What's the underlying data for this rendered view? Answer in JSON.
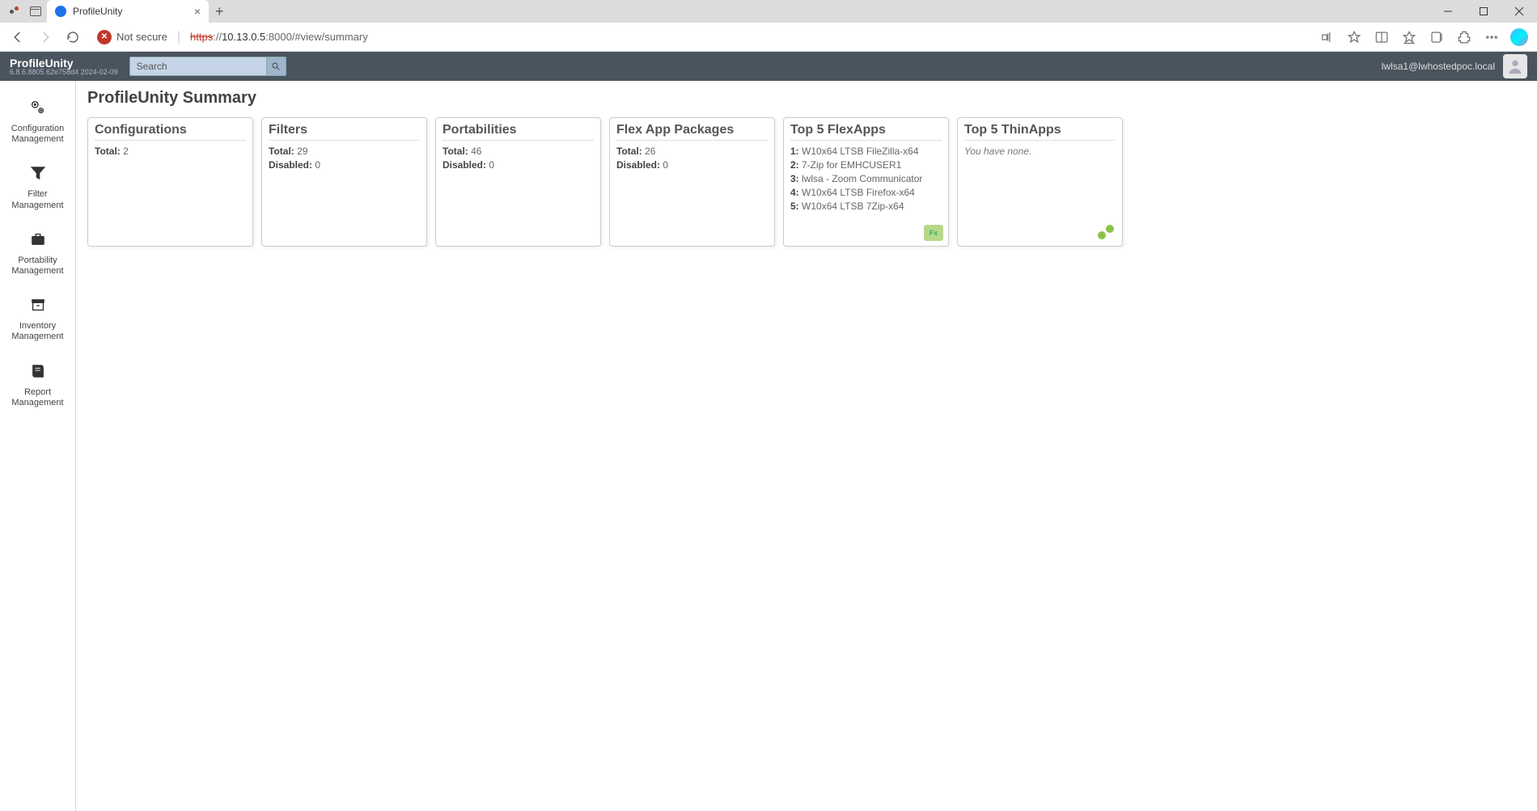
{
  "browser": {
    "tab_title": "ProfileUnity",
    "security_text": "Not secure",
    "url_https": "https",
    "url_sep": "://",
    "url_host": "10.13.0.5",
    "url_path": ":8000/#view/summary"
  },
  "header": {
    "brand": "ProfileUnity",
    "version": "6.8.6.8805 62e758d4 2024-02-09",
    "search_placeholder": "Search",
    "user": "lwlsa1@lwhostedpoc.local"
  },
  "sidebar": {
    "items": [
      {
        "label": "Configuration Management"
      },
      {
        "label": "Filter Management"
      },
      {
        "label": "Portability Management"
      },
      {
        "label": "Inventory Management"
      },
      {
        "label": "Report Management"
      }
    ]
  },
  "page": {
    "title": "ProfileUnity Summary"
  },
  "cards": {
    "configurations": {
      "title": "Configurations",
      "total_label": "Total:",
      "total": "2"
    },
    "filters": {
      "title": "Filters",
      "total_label": "Total:",
      "total": "29",
      "disabled_label": "Disabled:",
      "disabled": "0"
    },
    "portabilities": {
      "title": "Portabilities",
      "total_label": "Total:",
      "total": "46",
      "disabled_label": "Disabled:",
      "disabled": "0"
    },
    "flexapp": {
      "title": "Flex App Packages",
      "total_label": "Total:",
      "total": "26",
      "disabled_label": "Disabled:",
      "disabled": "0"
    },
    "top_flexapps": {
      "title": "Top 5 FlexApps",
      "items": [
        {
          "n": "1:",
          "name": "W10x64 LTSB FileZilla-x64"
        },
        {
          "n": "2:",
          "name": "7-Zip for EMHCUSER1"
        },
        {
          "n": "3:",
          "name": "lwlsa - Zoom Communicator"
        },
        {
          "n": "4:",
          "name": "W10x64 LTSB Firefox-x64"
        },
        {
          "n": "5:",
          "name": "W10x64 LTSB 7Zip-x64"
        }
      ]
    },
    "top_thinapps": {
      "title": "Top 5 ThinApps",
      "none_text": "You have none."
    }
  }
}
